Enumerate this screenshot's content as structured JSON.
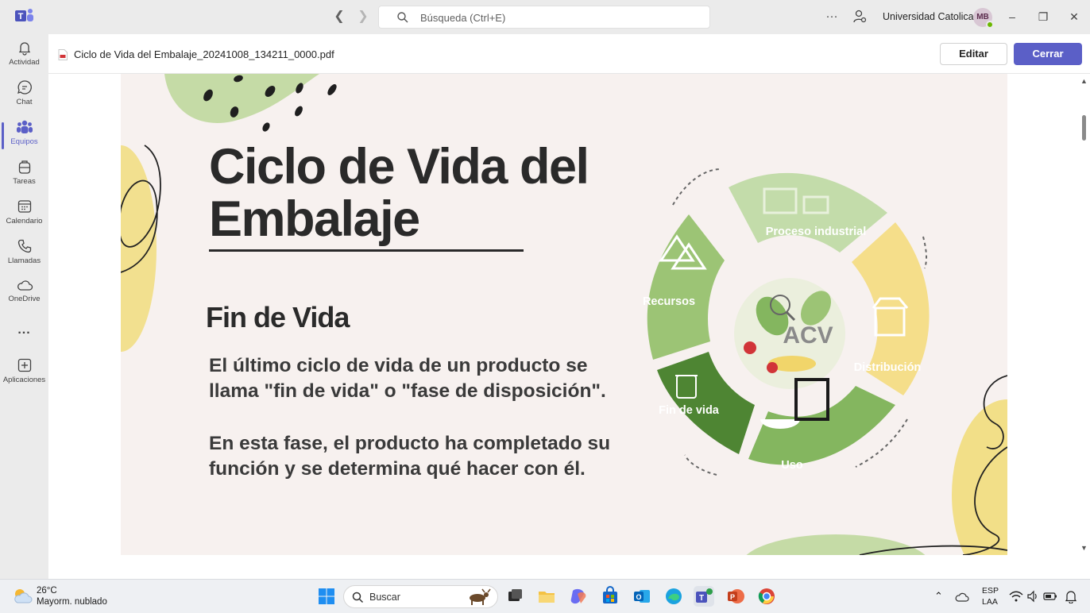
{
  "titlebar": {
    "search_placeholder": "Búsqueda (Ctrl+E)",
    "more_label": "···",
    "org_name": "Universidad Catolica ...",
    "avatar_initials": "MB"
  },
  "rail": {
    "items": [
      {
        "label": "Actividad"
      },
      {
        "label": "Chat"
      },
      {
        "label": "Equipos"
      },
      {
        "label": "Tareas"
      },
      {
        "label": "Calendario"
      },
      {
        "label": "Llamadas"
      },
      {
        "label": "OneDrive"
      },
      {
        "label": "..."
      },
      {
        "label": "Aplicaciones"
      }
    ]
  },
  "file": {
    "name": "Ciclo de Vida del Embalaje_20241008_134211_0000.pdf",
    "edit_label": "Editar",
    "close_label": "Cerrar"
  },
  "slide": {
    "title": "Ciclo de Vida del Embalaje",
    "subtitle": "Fin de Vida",
    "paragraph1": "El último ciclo de vida de un producto se llama \"fin de vida\" o \"fase de disposición\".",
    "paragraph2": "En esta fase, el producto ha completado su función y se determina qué hacer con él.",
    "diagram": {
      "center": "ACV",
      "stages": [
        "Proceso industrial",
        "Distribución",
        "Uso",
        "Fin de vida",
        "Recursos"
      ]
    }
  },
  "taskbar": {
    "temperature": "26°C",
    "weather": "Mayorm. nublado",
    "search_label": "Buscar",
    "lang1": "ESP",
    "lang2": "LAA"
  },
  "colors": {
    "accent": "#5b5fc7",
    "light_green": "#bcd79f",
    "mid_green": "#84b65f",
    "dark_green": "#4e8533",
    "yellow": "#f5de8a"
  }
}
